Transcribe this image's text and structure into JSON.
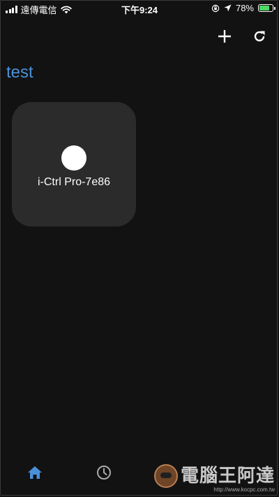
{
  "status_bar": {
    "carrier": "遠傳電信",
    "time": "下午9:24",
    "battery_percent": "78%",
    "battery_level": 0.78,
    "icons": [
      "signal-icon",
      "wifi-icon",
      "rotation-lock-icon",
      "location-arrow-icon",
      "battery-charging-icon"
    ]
  },
  "header": {
    "actions": [
      {
        "name": "add-button",
        "icon": "plus-icon"
      },
      {
        "name": "refresh-button",
        "icon": "refresh-icon"
      }
    ]
  },
  "page": {
    "title": "test"
  },
  "devices": [
    {
      "name": "i-Ctrl Pro-7e86",
      "icon": "device-status-dot"
    }
  ],
  "bottom_nav": {
    "items": [
      {
        "name": "home",
        "icon": "home-icon",
        "active": true
      },
      {
        "name": "history",
        "icon": "clock-icon",
        "active": false
      }
    ],
    "active_color": "#4a90d9",
    "inactive_color": "#aaaaaa"
  },
  "watermark": {
    "text": "電腦王阿達",
    "url": "http://www.kocpc.com.tw"
  },
  "colors": {
    "background": "#121212",
    "card": "#2b2b2b",
    "accent": "#4a90d9",
    "battery": "#4cd964"
  }
}
